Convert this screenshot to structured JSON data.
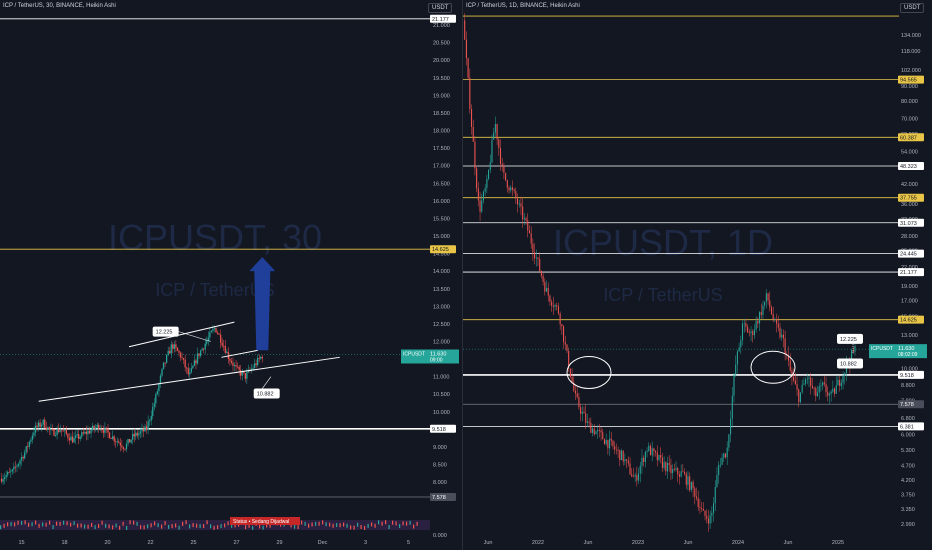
{
  "colors": {
    "background": "#131722",
    "up": "#26a69a",
    "down": "#ef5350",
    "white_level": "#ffffff",
    "yellow_level": "#e8c547",
    "gray_level": "#787b86",
    "arrow": "#1f3f9a",
    "grid_text": "#b2b5be",
    "watermark": "#1e2a45"
  },
  "left_panel": {
    "header": "ICP / TetherUS, 30, BINANCE, Heikin Ashi",
    "currency_tag": "USDT",
    "watermark_symbol": "ICPUSDT, 30",
    "watermark_name": "ICP / TetherUS",
    "last_price": {
      "symbol": "ICPUSDT",
      "value": "11.630",
      "countdown": "09:00"
    },
    "status_label": "Status • Sedang Dijadwal",
    "callouts": [
      "12.225",
      "10.882"
    ]
  },
  "right_panel": {
    "header": "ICP / TetherUS, 1D, BINANCE, Heikin Ashi",
    "currency_tag": "USDT",
    "watermark_symbol": "ICPUSDT, 1D",
    "watermark_name": "ICP / TetherUS",
    "last_price": {
      "symbol": "ICPUSDT",
      "value": "11.630",
      "countdown": "08:02:09"
    },
    "callouts": [
      "12.225",
      "10.882"
    ]
  },
  "chart_data": [
    {
      "type": "candlestick",
      "title": "ICP / TetherUS, 30, BINANCE, Heikin Ashi",
      "xlabel": "",
      "ylabel": "",
      "x_ticks": [
        "15",
        "18",
        "20",
        "22",
        "25",
        "27",
        "29",
        "Dec",
        "3",
        "5"
      ],
      "y_ticks": [
        "21.000",
        "20.500",
        "20.000",
        "19.500",
        "19.000",
        "18.500",
        "18.000",
        "17.500",
        "17.000",
        "16.500",
        "16.000",
        "15.500",
        "15.000",
        "14.500",
        "14.000",
        "13.500",
        "13.000",
        "12.500",
        "12.000",
        "11.500",
        "11.000",
        "10.500",
        "10.000",
        "9.500",
        "9.000",
        "8.500",
        "8.000"
      ],
      "ylim": [
        7.35,
        21.2
      ],
      "levels": [
        {
          "value": 21.177,
          "label": "21.177",
          "color": "white"
        },
        {
          "value": 14.625,
          "label": "14.625",
          "color": "yellow"
        },
        {
          "value": 9.518,
          "label": "9.518",
          "color": "white"
        },
        {
          "value": 7.578,
          "label": "7.578",
          "color": "gray"
        }
      ],
      "trendlines": [
        {
          "from": [
            "18",
            10.3
          ],
          "to": [
            "5",
            11.5
          ]
        },
        {
          "from": [
            "20",
            11.8
          ],
          "to": [
            "27",
            12.6
          ]
        },
        {
          "from": [
            "27",
            11.0
          ],
          "to": [
            "27",
            11.5
          ]
        }
      ],
      "annotations": [
        {
          "text": "12.225",
          "at": [
            "22",
            12.225
          ]
        },
        {
          "text": "10.882",
          "at": [
            "27",
            10.882
          ]
        }
      ],
      "projection_arrow": {
        "from": [
          "27",
          11.6
        ],
        "to": [
          "27",
          14.6
        ]
      },
      "last_value": 11.63,
      "volume_scale_label": "0.000",
      "trend_path": [
        [
          0,
          8.1
        ],
        [
          0.03,
          8.3
        ],
        [
          0.06,
          8.9
        ],
        [
          0.08,
          9.5
        ],
        [
          0.1,
          9.7
        ],
        [
          0.12,
          9.4
        ],
        [
          0.14,
          9.5
        ],
        [
          0.17,
          9.2
        ],
        [
          0.2,
          9.4
        ],
        [
          0.23,
          9.6
        ],
        [
          0.26,
          9.3
        ],
        [
          0.29,
          9.0
        ],
        [
          0.31,
          9.3
        ],
        [
          0.34,
          9.5
        ],
        [
          0.36,
          10.3
        ],
        [
          0.38,
          11.3
        ],
        [
          0.4,
          11.9
        ],
        [
          0.42,
          11.6
        ],
        [
          0.44,
          11.0
        ],
        [
          0.46,
          11.6
        ],
        [
          0.48,
          12.0
        ],
        [
          0.5,
          12.4
        ],
        [
          0.52,
          11.9
        ],
        [
          0.53,
          11.6
        ],
        [
          0.55,
          11.2
        ],
        [
          0.57,
          11.0
        ],
        [
          0.59,
          11.3
        ],
        [
          0.61,
          11.6
        ]
      ]
    },
    {
      "type": "candlestick",
      "title": "ICP / TetherUS, 1D, BINANCE, Heikin Ashi",
      "xlabel": "",
      "ylabel": "",
      "log_scale": true,
      "x_ticks": [
        "Jun",
        "2022",
        "Jun",
        "2023",
        "Jun",
        "2024",
        "Jun",
        "2025"
      ],
      "y_ticks": [
        "134.000",
        "118.000",
        "102.000",
        "90.000",
        "80.000",
        "70.000",
        "62.000",
        "54.000",
        "48.000",
        "42.000",
        "36.000",
        "32.000",
        "28.000",
        "25.000",
        "22.000",
        "19.000",
        "17.000",
        "15.000",
        "13.000",
        "11.500",
        "10.000",
        "8.800",
        "7.800",
        "6.800",
        "6.000",
        "5.300",
        "4.700",
        "4.200",
        "3.750",
        "3.350",
        "2.990"
      ],
      "ylim": [
        2.85,
        160
      ],
      "levels": [
        {
          "value": 155,
          "label": "",
          "color": "yellow"
        },
        {
          "value": 94.565,
          "label": "94.565",
          "color": "yellow"
        },
        {
          "value": 60.387,
          "label": "60.387",
          "color": "yellow"
        },
        {
          "value": 48.323,
          "label": "48.323",
          "color": "white"
        },
        {
          "value": 37.755,
          "label": "37.755",
          "color": "yellow"
        },
        {
          "value": 31.073,
          "label": "31.073",
          "color": "white"
        },
        {
          "value": 24.445,
          "label": "24.445",
          "color": "white"
        },
        {
          "value": 21.177,
          "label": "21.177",
          "color": "white"
        },
        {
          "value": 14.625,
          "label": "14.625",
          "color": "yellow"
        },
        {
          "value": 9.518,
          "label": "9.518",
          "color": "white"
        },
        {
          "value": 7.578,
          "label": "7.578",
          "color": "gray"
        },
        {
          "value": 6.381,
          "label": "6.381",
          "color": "white"
        }
      ],
      "highlight_ellipses": [
        {
          "center": [
            "Jun 2022",
            9.8
          ]
        },
        {
          "center": [
            "Feb 2024",
            10.2
          ]
        }
      ],
      "annotations": [
        {
          "text": "12.225",
          "at": [
            "Nov 2024",
            12.225
          ]
        },
        {
          "text": "10.882",
          "at": [
            "Nov 2024",
            10.882
          ]
        }
      ],
      "last_value": 11.63,
      "trend_path": [
        [
          0,
          150
        ],
        [
          0.02,
          70
        ],
        [
          0.04,
          34
        ],
        [
          0.06,
          42
        ],
        [
          0.08,
          68
        ],
        [
          0.1,
          45
        ],
        [
          0.13,
          38
        ],
        [
          0.16,
          30
        ],
        [
          0.19,
          22
        ],
        [
          0.21,
          18
        ],
        [
          0.24,
          15.5
        ],
        [
          0.26,
          11
        ],
        [
          0.28,
          8
        ],
        [
          0.31,
          6.5
        ],
        [
          0.34,
          6
        ],
        [
          0.37,
          5.5
        ],
        [
          0.4,
          5.0
        ],
        [
          0.43,
          4.2
        ],
        [
          0.46,
          5.4
        ],
        [
          0.49,
          4.9
        ],
        [
          0.52,
          4.5
        ],
        [
          0.55,
          4.4
        ],
        [
          0.58,
          3.8
        ],
        [
          0.6,
          3.2
        ],
        [
          0.62,
          3.1
        ],
        [
          0.64,
          4.8
        ],
        [
          0.66,
          5.3
        ],
        [
          0.68,
          10
        ],
        [
          0.7,
          14
        ],
        [
          0.72,
          13
        ],
        [
          0.74,
          15
        ],
        [
          0.76,
          17.5
        ],
        [
          0.78,
          14
        ],
        [
          0.8,
          12.5
        ],
        [
          0.82,
          9.5
        ],
        [
          0.84,
          8.0
        ],
        [
          0.86,
          9.4
        ],
        [
          0.88,
          8.1
        ],
        [
          0.9,
          8.7
        ],
        [
          0.92,
          8.0
        ],
        [
          0.94,
          9.0
        ],
        [
          0.96,
          10.3
        ],
        [
          0.98,
          11.6
        ]
      ]
    }
  ]
}
